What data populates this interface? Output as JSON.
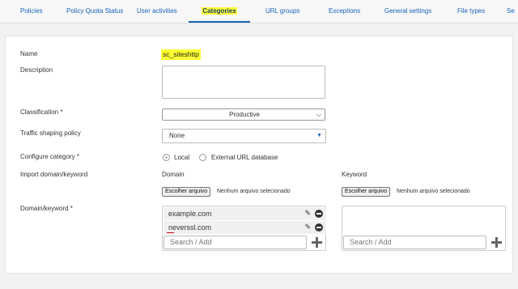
{
  "tabs": [
    {
      "label": "Policies"
    },
    {
      "label": "Policy Quota Status"
    },
    {
      "label": "User activities"
    },
    {
      "label": "Categories",
      "active": true
    },
    {
      "label": "URL groups"
    },
    {
      "label": "Exceptions"
    },
    {
      "label": "General settings"
    },
    {
      "label": "File types"
    },
    {
      "label": "Se"
    }
  ],
  "form": {
    "name_label": "Name",
    "name_value": "sc_siteshttp",
    "description_label": "Description",
    "description_value": "",
    "classification_label": "Classification *",
    "classification_value": "Productive",
    "traffic_label": "Traffic shaping policy",
    "traffic_value": "None",
    "configure_label": "Configure category *",
    "configure_options": [
      "Local",
      "External URL database"
    ],
    "configure_selected": "Local",
    "import_label": "Import domain/keyword",
    "domain_heading": "Domain",
    "keyword_heading": "Keyword",
    "file_button": "Escolher arquivo",
    "file_status": "Nenhum arquivo selecionado",
    "domain_keyword_label": "Domain/keyword *",
    "domains": [
      "example.com",
      "neverssl.com"
    ],
    "search_placeholder": "Search / Add"
  },
  "colors": {
    "link": "#1a63b8",
    "highlight": "#ffff33",
    "error_underline": "#dd0000"
  },
  "icons": {
    "edit": "pencil-icon",
    "remove": "minus-circle-icon",
    "add": "plus-icon",
    "dropdown": "chevron-down-icon"
  }
}
